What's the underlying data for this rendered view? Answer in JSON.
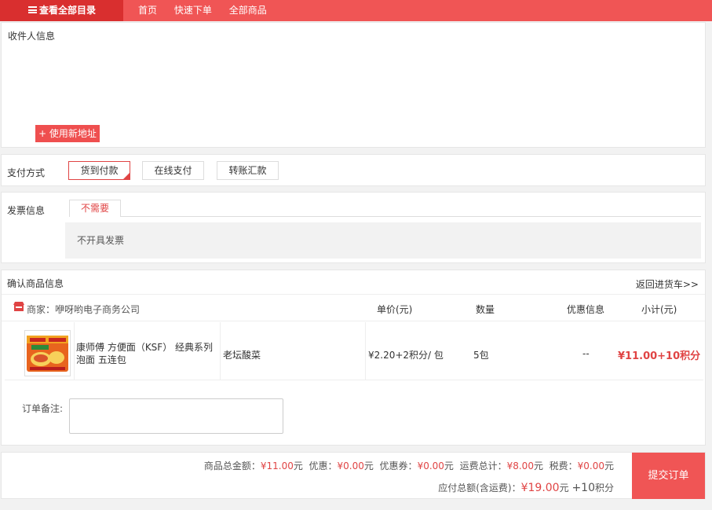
{
  "nav": {
    "category_label": "查看全部目录",
    "links": [
      "首页",
      "快速下单",
      "全部商品"
    ]
  },
  "address": {
    "title": "收件人信息",
    "new_address_label": "+ 使用新地址"
  },
  "payment": {
    "label": "支付方式",
    "options": [
      "货到付款",
      "在线支付",
      "转账汇款"
    ],
    "selected": "货到付款"
  },
  "invoice": {
    "label": "发票信息",
    "tab": "不需要",
    "content": "不开具发票"
  },
  "goods": {
    "title": "确认商品信息",
    "back_link": "返回进货车>>",
    "merchant": "商家：咿呀哟电子商务公司",
    "columns": [
      "单价(元)",
      "数量",
      "优惠信息",
      "小计(元)"
    ],
    "items": [
      {
        "name": "康师傅 方便面（KSF） 经典系列 泡面 五连包",
        "spec": "老坛酸菜",
        "unit_price": "¥2.20+2积分/ 包",
        "quantity": "5包",
        "discount": "--",
        "subtotal": "¥11.00+10积分"
      }
    ],
    "remark_label": "订单备注:"
  },
  "summary": {
    "goods_total_label": "商品总金额：",
    "goods_total": "¥11.00",
    "discount_label": "优惠：",
    "discount": "¥0.00",
    "coupon_label": "优惠券：",
    "coupon": "¥0.00",
    "shipping_label": "运费总计：",
    "shipping": "¥8.00",
    "tax_label": "税费：",
    "tax": "¥0.00",
    "yuan": "元",
    "payable_label": "应付总额(含运费)：",
    "payable": "¥19.00",
    "points": "+10",
    "points_unit": "积分",
    "submit_label": "提交订单"
  },
  "colors": {
    "brand": "#f05555",
    "accent": "#e04444"
  }
}
